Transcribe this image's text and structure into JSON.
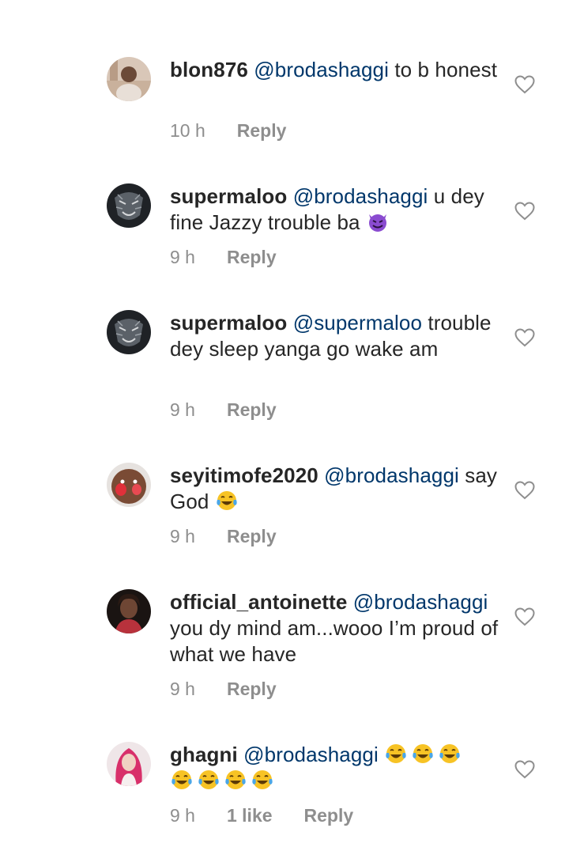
{
  "comments": [
    {
      "username": "blon876",
      "mention": "@brodashaggi",
      "text": " to b honest",
      "emoji_names": [],
      "time": "10 h",
      "likes": "",
      "reply_label": "Reply",
      "avatar": "avatar-portrait-light"
    },
    {
      "username": "supermaloo",
      "mention": "@brodashaggi",
      "text": " u dey fine Jazzy trouble ba ",
      "emoji_names": [
        "smiling-imp-emoji"
      ],
      "time": "9 h",
      "likes": "",
      "reply_label": "Reply",
      "avatar": "avatar-tiger"
    },
    {
      "username": "supermaloo",
      "mention": "@supermaloo",
      "text": " trouble dey sleep yanga go wake am",
      "emoji_names": [],
      "time": "9 h",
      "likes": "",
      "reply_label": "Reply",
      "avatar": "avatar-tiger"
    },
    {
      "username": "seyitimofe2020",
      "mention": "@brodashaggi",
      "text": " say God ",
      "emoji_names": [
        "tears-of-joy-emoji"
      ],
      "time": "9 h",
      "likes": "",
      "reply_label": "Reply",
      "avatar": "avatar-face-paint"
    },
    {
      "username": "official_antoinette",
      "mention": "@brodashaggi",
      "text": " you dy mind am...wooo I’m proud of what we have",
      "emoji_names": [],
      "time": "9 h",
      "likes": "",
      "reply_label": "Reply",
      "avatar": "avatar-portrait-dark"
    },
    {
      "username": "ghagni",
      "mention": "@brodashaggi",
      "text": " ",
      "emoji_names": [
        "tears-of-joy-emoji",
        "tears-of-joy-emoji",
        "tears-of-joy-emoji",
        "tears-of-joy-emoji",
        "tears-of-joy-emoji",
        "tears-of-joy-emoji",
        "tears-of-joy-emoji"
      ],
      "time": "9 h",
      "likes": "1 like",
      "reply_label": "Reply",
      "avatar": "avatar-pink-hair"
    }
  ],
  "icons": {
    "heart": "heart-outline-icon"
  },
  "colors": {
    "username": "#262626",
    "mention": "#00376b",
    "meta": "#8e8e8e",
    "heart": "#8e8e8e"
  }
}
